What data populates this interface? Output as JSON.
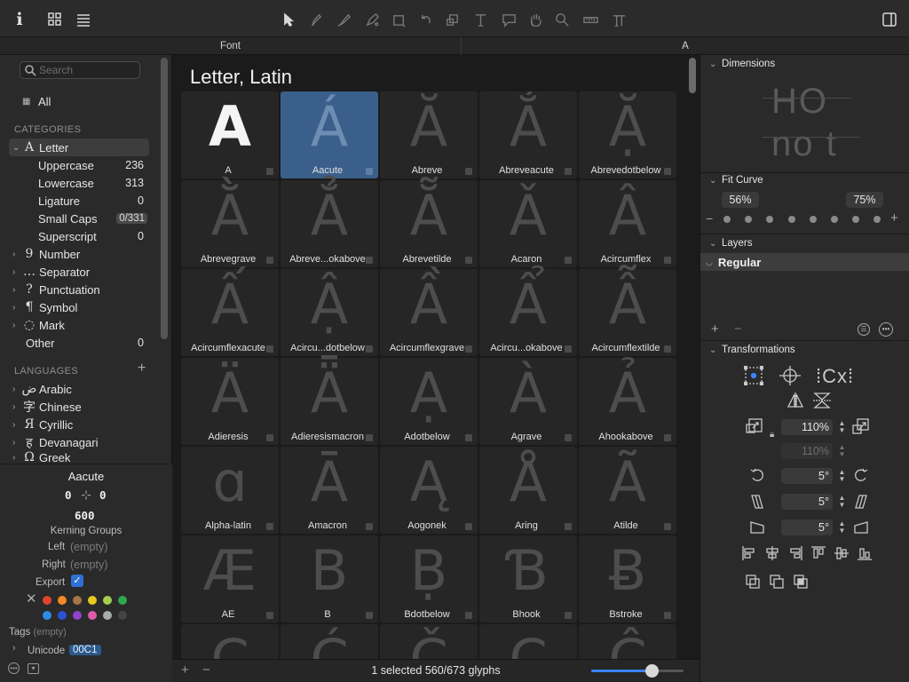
{
  "toolbar": {
    "left_icons": [
      "info-icon",
      "grid-view-icon",
      "list-view-icon"
    ],
    "tools": [
      "select-tool-icon",
      "draw-tool-icon",
      "pen-tool-icon",
      "brush-tool-icon",
      "primitives-tool-icon",
      "rotate-tool-icon",
      "scale-tool-icon",
      "text-tool-icon",
      "annotation-tool-icon",
      "hand-tool-icon",
      "zoom-tool-icon",
      "measure-tool-icon",
      "hint-tool-icon"
    ],
    "right_icon": "sidebar-toggle-icon"
  },
  "tabs": [
    {
      "label": "Font"
    },
    {
      "label": "A"
    }
  ],
  "sidebar": {
    "search_placeholder": "Search",
    "all_label": "All",
    "categories_header": "CATEGORIES",
    "categories": [
      {
        "label": "Letter",
        "icon": "A",
        "expanded": true,
        "count": ""
      },
      {
        "label": "Uppercase",
        "count": "236",
        "sub": true
      },
      {
        "label": "Lowercase",
        "count": "313",
        "sub": true
      },
      {
        "label": "Ligature",
        "count": "0",
        "sub": true
      },
      {
        "label": "Small Caps",
        "count": "0/331",
        "sub": true,
        "badge": true
      },
      {
        "label": "Superscript",
        "count": "0",
        "sub": true
      },
      {
        "label": "Number",
        "icon": "9",
        "count": ""
      },
      {
        "label": "Separator",
        "icon": "…",
        "count": ""
      },
      {
        "label": "Punctuation",
        "icon": "?",
        "count": ""
      },
      {
        "label": "Symbol",
        "icon": "¶",
        "count": ""
      },
      {
        "label": "Mark",
        "icon": "◌",
        "count": ""
      },
      {
        "label": "Other",
        "icon": "",
        "count": "0"
      }
    ],
    "languages_header": "LANGUAGES",
    "languages": [
      {
        "label": "Arabic",
        "icon": "ض"
      },
      {
        "label": "Chinese",
        "icon": "字"
      },
      {
        "label": "Cyrillic",
        "icon": "Я"
      },
      {
        "label": "Devanagari",
        "icon": "ह"
      },
      {
        "label": "Greek",
        "icon": "Ω"
      }
    ]
  },
  "glyph_info": {
    "name": "Aacute",
    "lsb": "0",
    "rsb": "0",
    "width": "600",
    "kerning_groups_label": "Kerning Groups",
    "left_label": "Left",
    "left_value": "(empty)",
    "right_label": "Right",
    "right_value": "(empty)",
    "export_label": "Export",
    "export_checked": true,
    "label_colors": [
      "#e0452b",
      "#f08a24",
      "#a5774a",
      "#e6c81e",
      "#a3cf4f",
      "#2ea84a",
      "#2e8be6",
      "#2a52d6",
      "#8e44c9",
      "#e05aa8",
      "#aaaaaa",
      "#444444"
    ],
    "tags_label": "Tags",
    "tags_value": "(empty)",
    "unicode_label": "Unicode",
    "unicode_value": "00C1"
  },
  "main": {
    "title": "Letter, Latin",
    "glyphs": [
      {
        "name": "A",
        "char": "A",
        "selected": false
      },
      {
        "name": "Aacute",
        "char": "Á",
        "selected": true
      },
      {
        "name": "Abreve",
        "char": "Ă",
        "selected": false
      },
      {
        "name": "Abreveacute",
        "char": "Ắ",
        "selected": false
      },
      {
        "name": "Abrevedotbelow",
        "char": "Ặ",
        "selected": false
      },
      {
        "name": "Abrevegrave",
        "char": "Ằ",
        "selected": false
      },
      {
        "name": "Abreve...okabove",
        "char": "Ẳ",
        "selected": false
      },
      {
        "name": "Abrevetilde",
        "char": "Ẵ",
        "selected": false
      },
      {
        "name": "Acaron",
        "char": "Ǎ",
        "selected": false
      },
      {
        "name": "Acircumflex",
        "char": "Â",
        "selected": false
      },
      {
        "name": "Acircumflexacute",
        "char": "Ấ",
        "selected": false
      },
      {
        "name": "Acircu...dotbelow",
        "char": "Ậ",
        "selected": false
      },
      {
        "name": "Acircumflexgrave",
        "char": "Ầ",
        "selected": false
      },
      {
        "name": "Acircu...okabove",
        "char": "Ẩ",
        "selected": false
      },
      {
        "name": "Acircumflextilde",
        "char": "Ẫ",
        "selected": false
      },
      {
        "name": "Adieresis",
        "char": "Ä",
        "selected": false
      },
      {
        "name": "Adieresismacron",
        "char": "Ǟ",
        "selected": false
      },
      {
        "name": "Adotbelow",
        "char": "Ạ",
        "selected": false
      },
      {
        "name": "Agrave",
        "char": "À",
        "selected": false
      },
      {
        "name": "Ahookabove",
        "char": "Ả",
        "selected": false
      },
      {
        "name": "Alpha-latin",
        "char": "ɑ",
        "selected": false
      },
      {
        "name": "Amacron",
        "char": "Ā",
        "selected": false
      },
      {
        "name": "Aogonek",
        "char": "Ą",
        "selected": false
      },
      {
        "name": "Aring",
        "char": "Å",
        "selected": false
      },
      {
        "name": "Atilde",
        "char": "Ã",
        "selected": false
      },
      {
        "name": "AE",
        "char": "Æ",
        "selected": false
      },
      {
        "name": "B",
        "char": "B",
        "selected": false
      },
      {
        "name": "Bdotbelow",
        "char": "Ḅ",
        "selected": false
      },
      {
        "name": "Bhook",
        "char": "Ɓ",
        "selected": false
      },
      {
        "name": "Bstroke",
        "char": "Ƀ",
        "selected": false
      },
      {
        "name": "",
        "char": "C",
        "selected": false
      },
      {
        "name": "",
        "char": "Ć",
        "selected": false
      },
      {
        "name": "",
        "char": "Č",
        "selected": false
      },
      {
        "name": "",
        "char": "C",
        "selected": false
      },
      {
        "name": "",
        "char": "Ĉ",
        "selected": false
      }
    ],
    "status": "1 selected 560/673 glyphs",
    "zoom_fraction": 0.65
  },
  "inspector": {
    "dimensions_label": "Dimensions",
    "fit_curve_label": "Fit Curve",
    "fit_curve_min": "56%",
    "fit_curve_max": "75%",
    "layers_label": "Layers",
    "layer_name": "Regular",
    "transformations_label": "Transformations",
    "scale_x": "110%",
    "scale_y": "110%",
    "rotate": "5°",
    "slant": "5°",
    "skew": "5°"
  }
}
